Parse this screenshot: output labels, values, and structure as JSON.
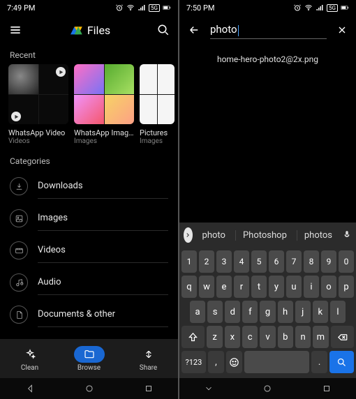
{
  "left": {
    "time": "7:49 PM",
    "signal_label": "5G",
    "app_title": "Files",
    "recent_label": "Recent",
    "recent": [
      {
        "name": "WhatsApp Video",
        "sub": "Videos"
      },
      {
        "name": "WhatsApp Images",
        "sub": "Images"
      },
      {
        "name": "Pictures",
        "sub": "Images"
      }
    ],
    "categories_label": "Categories",
    "categories": [
      {
        "label": "Downloads"
      },
      {
        "label": "Images"
      },
      {
        "label": "Videos"
      },
      {
        "label": "Audio"
      },
      {
        "label": "Documents & other"
      }
    ],
    "tabs": {
      "clean": "Clean",
      "browse": "Browse",
      "share": "Share"
    }
  },
  "right": {
    "time": "7:50 PM",
    "signal_label": "5G",
    "search_value": "photo",
    "result": "home-hero-photo2@2x.png",
    "suggestions": [
      "photo",
      "Photoshop",
      "photos"
    ],
    "rows": {
      "nums": [
        "1",
        "2",
        "3",
        "4",
        "5",
        "6",
        "7",
        "8",
        "9",
        "0"
      ],
      "r1": [
        "q",
        "w",
        "e",
        "r",
        "t",
        "y",
        "u",
        "i",
        "o",
        "p"
      ],
      "r2": [
        "a",
        "s",
        "d",
        "f",
        "g",
        "h",
        "j",
        "k",
        "l"
      ],
      "r3": [
        "z",
        "x",
        "c",
        "v",
        "b",
        "n",
        "m"
      ],
      "sym": "?123",
      "comma": ",",
      "period": "."
    }
  }
}
